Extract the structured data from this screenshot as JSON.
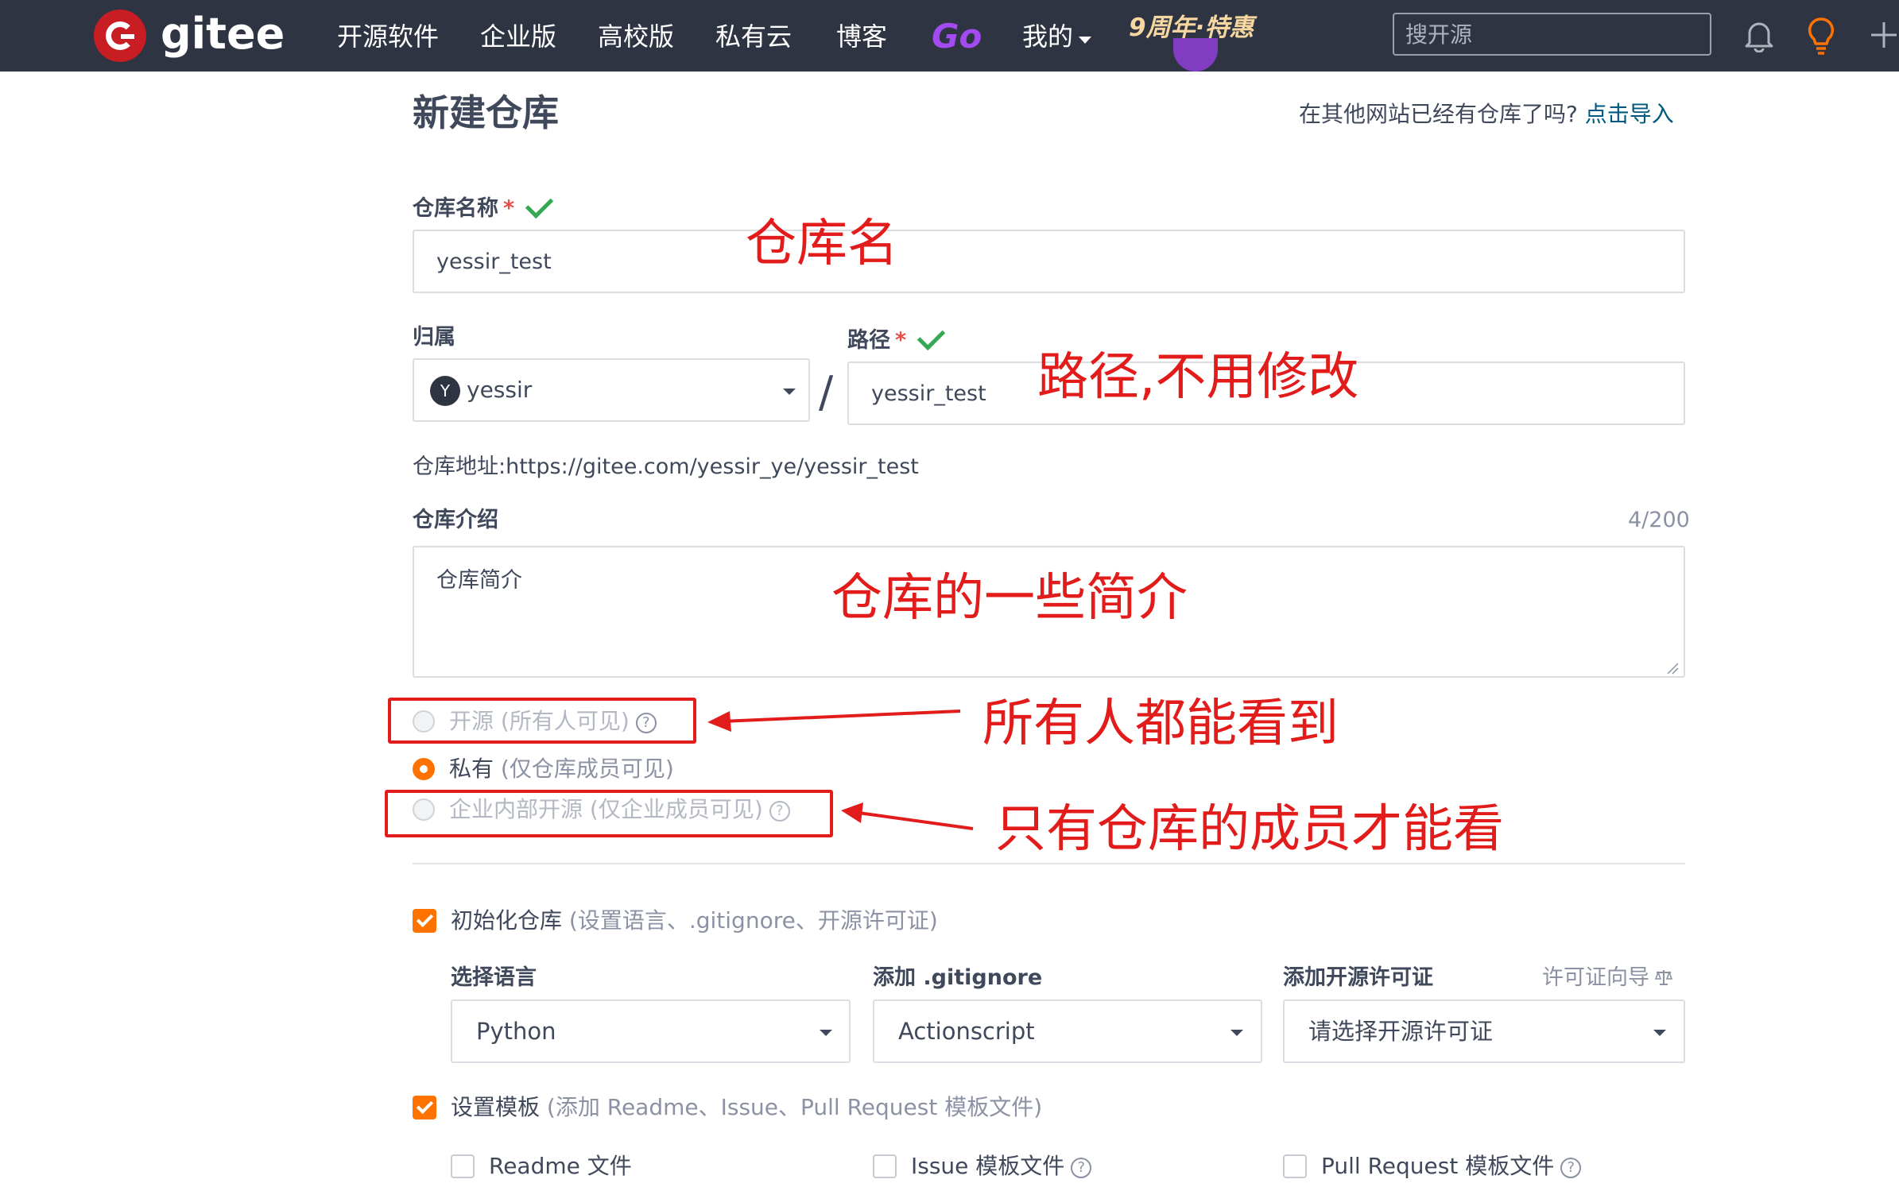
{
  "nav": {
    "logo_text": "gitee",
    "links": [
      "开源软件",
      "企业版",
      "高校版",
      "私有云",
      "博客"
    ],
    "go_label": "Go",
    "mine_label": "我的",
    "promo_label": "9周年·特惠",
    "search_placeholder": "搜开源"
  },
  "header": {
    "title": "新建仓库",
    "import_prompt": "在其他网站已经有仓库了吗?",
    "import_link": "点击导入"
  },
  "form": {
    "repo_name_label": "仓库名称",
    "required_mark": "*",
    "repo_name_value": "yessir_test",
    "owner_label": "归属",
    "owner_avatar": "Y",
    "owner_value": "yessir",
    "slash": "/",
    "path_label": "路径",
    "path_value": "yessir_test",
    "repo_url_label": "仓库地址:",
    "repo_url_value": "https://gitee.com/yessir_ye/yessir_test",
    "desc_label": "仓库介绍",
    "desc_count": "4/200",
    "desc_value": "仓库简介",
    "visibility": [
      {
        "label": "开源",
        "hint": "(所有人可见)",
        "selected": false,
        "disabled": true
      },
      {
        "label": "私有",
        "hint": "(仅仓库成员可见)",
        "selected": true,
        "disabled": false
      },
      {
        "label": "企业内部开源",
        "hint": "(仅企业成员可见)",
        "selected": false,
        "disabled": true
      }
    ],
    "help_glyph": "?",
    "init_label": "初始化仓库",
    "init_hint": "(设置语言、.gitignore、开源许可证)",
    "lang_label": "选择语言",
    "lang_value": "Python",
    "gitignore_label": "添加 .gitignore",
    "gitignore_value": "Actionscript",
    "license_label": "添加开源许可证",
    "license_wizard": "许可证向导",
    "license_value": "请选择开源许可证",
    "template_label": "设置模板",
    "template_hint": "(添加 Readme、Issue、Pull Request 模板文件)",
    "template_files": [
      "Readme 文件",
      "Issue 模板文件",
      "Pull Request 模板文件"
    ]
  },
  "annotations": {
    "repo_name": "仓库名",
    "path": "路径,不用修改",
    "desc": "仓库的一些简介",
    "public": "所有人都能看到",
    "private": "只有仓库的成员才能看"
  },
  "colors": {
    "nav_bg": "#2e3442",
    "accent": "#fe7300",
    "link": "#005980",
    "annotation_red": "#e21b1b",
    "valid_green": "#34a853"
  }
}
